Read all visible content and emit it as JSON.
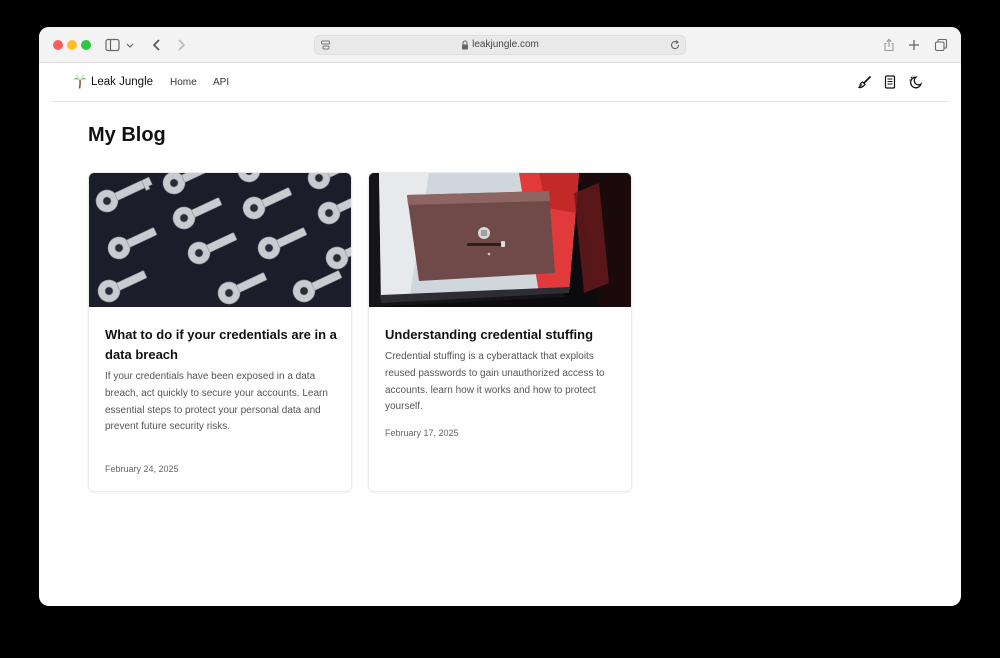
{
  "browser": {
    "url": "leakjungle.com"
  },
  "site": {
    "brand": "Leak Jungle",
    "nav": [
      {
        "label": "Home"
      },
      {
        "label": "API"
      }
    ],
    "right_icons": [
      "brush-icon",
      "document-icon",
      "theme-toggle-icon"
    ]
  },
  "page": {
    "title": "My Blog"
  },
  "posts": [
    {
      "title": "What to do if your credentials are in a data breach",
      "description": "If your credentials have been exposed in a data breach, act quickly to secure your accounts. Learn essential steps to protect your personal data and prevent future security risks.",
      "date": "February 24, 2025",
      "image": "keys-photo"
    },
    {
      "title": "Understanding credential stuffing",
      "description": "Credential stuffing is a cyberattack that exploits reused passwords to gain unauthorized access to accounts. learn how it works and how to protect yourself.",
      "date": "February 17, 2025",
      "image": "laptop-photo"
    }
  ],
  "colors": {
    "window_bg": "#ffffff",
    "chrome_bg": "#f3f3f3",
    "close": "#fe5f57",
    "minimize": "#febc2e",
    "maximize": "#28c840"
  }
}
